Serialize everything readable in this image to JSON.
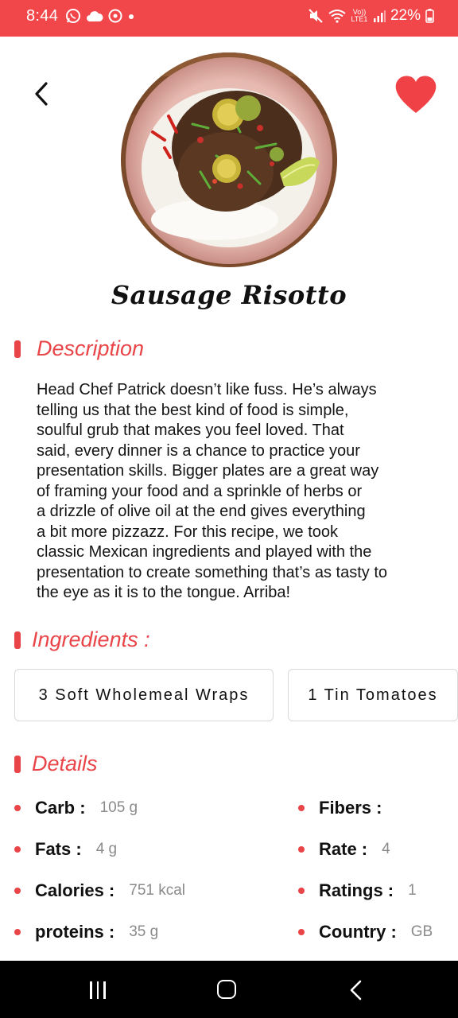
{
  "status_bar": {
    "time": "8:44",
    "battery": "22%",
    "network_label": "Vo)) LTE1",
    "icons": [
      "whatsapp-icon",
      "cloud-icon",
      "football-icon",
      "notification-dot",
      "mute-icon",
      "wifi-icon",
      "signal-icon",
      "battery-icon"
    ]
  },
  "header": {
    "back_icon": "chevron-left-icon",
    "favorite_icon": "heart-icon",
    "favorite_color": "#f04246"
  },
  "recipe": {
    "title": "Sausage Risotto",
    "image": "stir-fry-rice-plate"
  },
  "description": {
    "heading": "Description",
    "text": "Head Chef Patrick doesn’t like fuss. He’s always\ntelling us that the best kind of food is simple,\nsoulful grub that makes you feel loved. That\nsaid, every dinner is a chance to practice your\npresentation skills. Bigger plates are a great way\nof framing your food and a sprinkle of herbs or\na drizzle of olive oil at the end gives everything\na bit more pizzazz. For this recipe, we took\nclassic Mexican ingredients and played with the\npresentation to create something that’s as tasty to\nthe eye as it is to the tongue. Arriba!"
  },
  "ingredients": {
    "heading": "Ingredients :",
    "items": [
      "3 Soft Wholemeal Wraps",
      "1 Tin Tomatoes"
    ]
  },
  "details": {
    "heading": "Details",
    "left": [
      {
        "label": "Carb :",
        "value": "105 g"
      },
      {
        "label": "Fats :",
        "value": "4 g"
      },
      {
        "label": "Calories :",
        "value": "751 kcal"
      },
      {
        "label": "proteins :",
        "value": "35 g"
      }
    ],
    "right": [
      {
        "label": "Fibers :",
        "value": ""
      },
      {
        "label": "Rate :",
        "value": "4"
      },
      {
        "label": "Ratings :",
        "value": "1"
      },
      {
        "label": "Country :",
        "value": "GB"
      }
    ]
  },
  "colors": {
    "accent": "#e94548",
    "status_bar": "#f2474a",
    "value_gray": "#8a8a8a"
  },
  "nav_bar": {
    "icons": [
      "recent-apps-icon",
      "home-icon",
      "back-icon"
    ]
  }
}
